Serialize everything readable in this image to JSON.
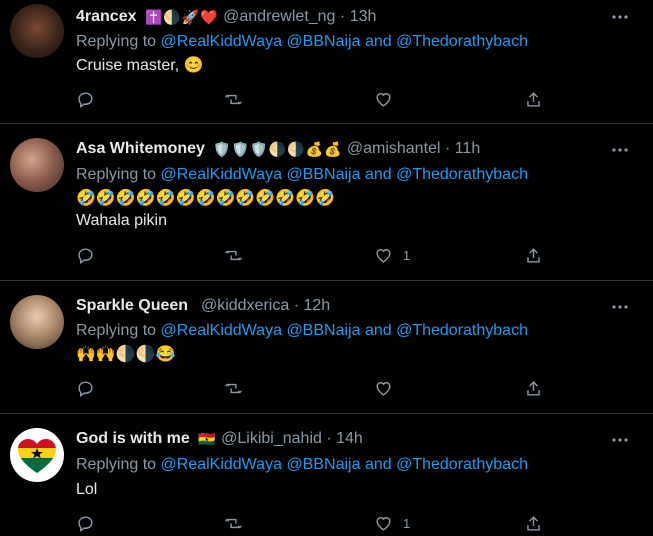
{
  "tweets": [
    {
      "name": "4rancex",
      "badges": "✝️🌗🚀❤️",
      "handle": "@andrewlet_ng",
      "sep": "·",
      "time": "13h",
      "reply_prefix": "Replying to",
      "mentions": [
        "@RealKiddWaya",
        "@BBNaija"
      ],
      "and": "and",
      "last_mention": "@Thedorathybach",
      "text": "Cruise master, 😊",
      "likes": ""
    },
    {
      "name": "Asa Whitemoney",
      "badges": "🛡️🛡️🛡️🌗🌗💰💰",
      "handle": "@amishantel",
      "sep": "·",
      "time": "11h",
      "reply_prefix": "Replying to",
      "mentions": [
        "@RealKiddWaya",
        "@BBNaija"
      ],
      "and": "and",
      "last_mention": "@Thedorathybach",
      "emoji_line": "🤣🤣🤣🤣🤣🤣🤣🤣🤣🤣🤣🤣🤣",
      "text": "Wahala pikin",
      "likes": "1"
    },
    {
      "name": "Sparkle Queen",
      "badges": "",
      "handle": "@kiddxerica",
      "sep": "·",
      "time": "12h",
      "reply_prefix": "Replying to",
      "mentions": [
        "@RealKiddWaya",
        "@BBNaija"
      ],
      "and": "and",
      "last_mention": "@Thedorathybach",
      "text": "🙌🙌🌗🌗😂",
      "likes": ""
    },
    {
      "name": "God is with me",
      "badges": "🇬🇭",
      "handle": "@Likibi_nahid",
      "sep": "·",
      "time": "14h",
      "reply_prefix": "Replying to",
      "mentions": [
        "@RealKiddWaya",
        "@BBNaija"
      ],
      "and": "and",
      "last_mention": "@Thedorathybach",
      "text": "Lol",
      "likes": "1"
    }
  ],
  "icons": {
    "reply": "reply-icon",
    "retweet": "retweet-icon",
    "like": "heart-icon",
    "share": "share-icon",
    "more": "more-icon"
  },
  "colors": {
    "background": "#000000",
    "link": "#1d9bf0",
    "muted": "#8b98a5",
    "text": "#e7e9ea",
    "divider": "#2f3336"
  }
}
